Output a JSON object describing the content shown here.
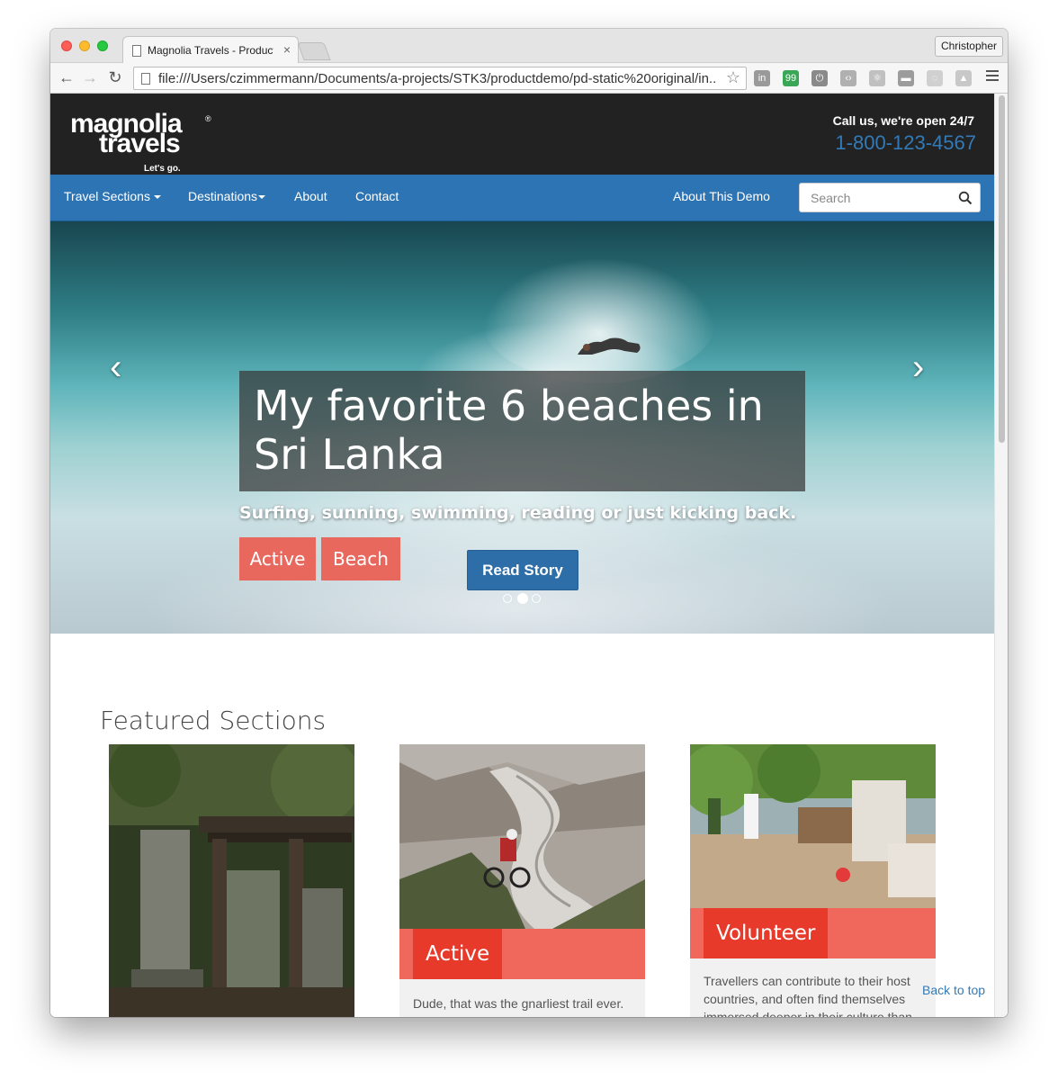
{
  "browser": {
    "tab_title": "Magnolia Travels - Product",
    "tab_close": "×",
    "profile": "Christopher",
    "url": "file:///Users/czimmermann/Documents/a-projects/STK3/productdemo/pd-static%20original/in...",
    "nav": {
      "back": "←",
      "forward": "→",
      "reload": "↻",
      "star": "☆"
    },
    "extensions": [
      {
        "name": "linkedin-extension",
        "label": "in",
        "color": "#9a9a9a"
      },
      {
        "name": "hangouts-extension",
        "label": "99",
        "color": "#3aa757"
      },
      {
        "name": "power-extension",
        "label": "⏻",
        "color": "#8a8a8a"
      },
      {
        "name": "source-extension",
        "label": "‹›",
        "color": "#b0b0b0"
      },
      {
        "name": "react-extension",
        "label": "⚛",
        "color": "#c0c0c0"
      },
      {
        "name": "window-extension",
        "label": "▬",
        "color": "#9c9c9c"
      },
      {
        "name": "spinner-extension",
        "label": "◌",
        "color": "#d0d0d0"
      },
      {
        "name": "drive-extension",
        "label": "▲",
        "color": "#c8c8c8"
      }
    ]
  },
  "header": {
    "logo_line1": "magnolia",
    "logo_line2": "travels",
    "logo_reg": "®",
    "logo_tagline": "Let's go.",
    "call_label": "Call us, we're open 24/7",
    "phone": "1-800-123-4567"
  },
  "nav": {
    "items": [
      "Travel Sections",
      "Destinations",
      "About",
      "Contact"
    ],
    "about_demo": "About This Demo",
    "search_placeholder": "Search"
  },
  "hero": {
    "title": "My favorite 6 beaches in Sri Lanka",
    "subtitle": "Surfing, sunning, swimming, reading or just kicking back.",
    "tags": [
      "Active",
      "Beach"
    ],
    "cta": "Read Story",
    "prev_arrow": "‹",
    "next_arrow": "›",
    "slide_count": 3,
    "active_slide": 2
  },
  "featured": {
    "heading": "Featured Sections",
    "cards": [
      {
        "label": "",
        "text": ""
      },
      {
        "label": "Active",
        "text": "Dude, that was the gnarliest trail ever."
      },
      {
        "label": "Volunteer",
        "text": "Travellers can contribute to their host countries, and often find themselves immersed deeper in their culture than"
      }
    ]
  },
  "back_to_top": "Back to top",
  "colors": {
    "header_bg": "#222222",
    "nav_bg": "#2d74b4",
    "phone": "#337ab7",
    "tag_bg": "#e8685e",
    "card_label_bg": "#e73a2b",
    "card_band_bg": "#f0675c"
  }
}
